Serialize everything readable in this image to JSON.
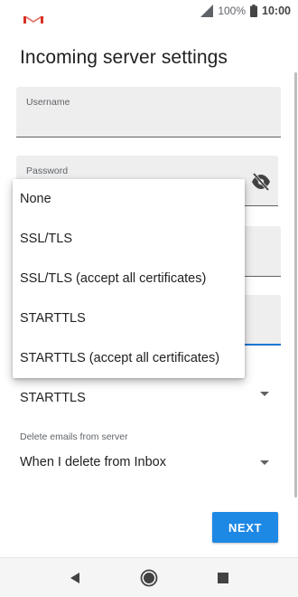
{
  "status_bar": {
    "battery_percent": "100%",
    "time": "10:00",
    "icons": [
      "gmail-logo-icon",
      "signal-icon",
      "battery-icon"
    ]
  },
  "page": {
    "title": "Incoming server settings"
  },
  "fields": {
    "username_label": "Username",
    "password_label": "Password"
  },
  "security": {
    "selected": "STARTTLS"
  },
  "delete": {
    "label": "Delete emails from server",
    "selected": "When I delete from Inbox"
  },
  "actions": {
    "next_label": "NEXT"
  },
  "menu": {
    "items": [
      {
        "label": "None"
      },
      {
        "label": "SSL/TLS"
      },
      {
        "label": "SSL/TLS (accept all certificates)"
      },
      {
        "label": "STARTTLS"
      },
      {
        "label": "STARTTLS (accept all certificates)"
      }
    ]
  },
  "nav": {
    "icons": [
      "back-icon",
      "home-icon",
      "recents-icon"
    ]
  },
  "colors": {
    "accent": "#1e88e5",
    "focus_underline": "#1976d2",
    "field_bg": "#eeeeee"
  }
}
